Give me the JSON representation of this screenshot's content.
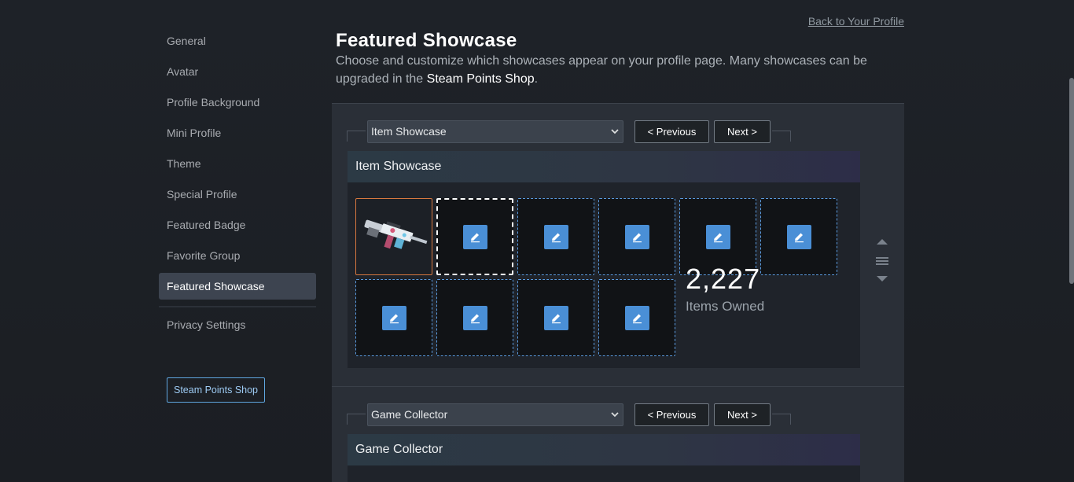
{
  "sidebar": {
    "items": [
      {
        "label": "General",
        "active": false
      },
      {
        "label": "Avatar",
        "active": false
      },
      {
        "label": "Profile Background",
        "active": false
      },
      {
        "label": "Mini Profile",
        "active": false
      },
      {
        "label": "Theme",
        "active": false
      },
      {
        "label": "Special Profile",
        "active": false
      },
      {
        "label": "Featured Badge",
        "active": false
      },
      {
        "label": "Favorite Group",
        "active": false
      },
      {
        "label": "Featured Showcase",
        "active": true
      }
    ],
    "privacy_label": "Privacy Settings",
    "points_shop_button": "Steam Points Shop"
  },
  "header": {
    "back_link": "Back to Your Profile",
    "title": "Featured Showcase",
    "description_prefix": "Choose and customize which showcases appear on your profile page. Many showcases can be upgraded in the ",
    "description_link": "Steam Points Shop",
    "description_suffix": "."
  },
  "showcases": [
    {
      "select_value": "Item Showcase",
      "prev_label": "< Previous",
      "next_label": "Next >",
      "title": "Item Showcase",
      "items_count": "2,227",
      "items_label": "Items Owned",
      "slots_filled": 1,
      "slots_total": 10
    },
    {
      "select_value": "Game Collector",
      "prev_label": "< Previous",
      "next_label": "Next >",
      "title": "Game Collector"
    }
  ],
  "colors": {
    "accent_blue": "#4a8fd6",
    "active_nav": "#3d4450",
    "filled_slot_border": "#d7773f"
  },
  "icons": {
    "edit": "pencil-edit-icon",
    "reorder_up": "triangle-up-icon",
    "reorder_handle": "drag-handle-icon",
    "reorder_down": "triangle-down-icon",
    "select_chevron": "chevron-down-icon"
  }
}
